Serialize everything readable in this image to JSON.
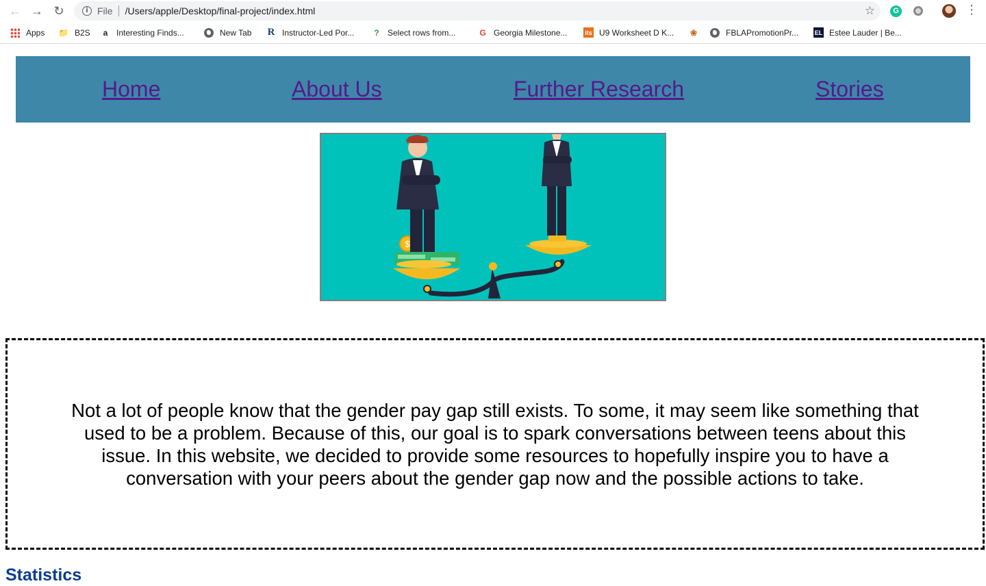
{
  "browser": {
    "scheme_label": "File",
    "url": "/Users/apple/Desktop/final-project/index.html",
    "bookmarks": [
      {
        "label": "Apps",
        "icon": "apps-grid-icon"
      },
      {
        "label": "B2S",
        "icon": "folder-icon"
      },
      {
        "label": "Interesting Finds...",
        "icon": "amazon-icon"
      },
      {
        "label": "New Tab",
        "icon": "globe-icon"
      },
      {
        "label": "Instructor-Led Por...",
        "icon": "r-logo-icon"
      },
      {
        "label": "Select rows from...",
        "icon": "question-icon"
      },
      {
        "label": "Georgia Milestone...",
        "icon": "google-icon"
      },
      {
        "label": "U9 Worksheet D K...",
        "icon": "its-icon"
      },
      {
        "label": "",
        "icon": "flower-icon"
      },
      {
        "label": "FBLAPromotionPr...",
        "icon": "globe-icon"
      },
      {
        "label": "Estee Lauder | Be...",
        "icon": "el-icon"
      }
    ]
  },
  "nav": {
    "home": "Home",
    "about": "About Us",
    "research": "Further Research",
    "stories": "Stories"
  },
  "intro": {
    "text": "Not a lot of people know that the gender pay gap still exists. To some, it may seem like something that used to be a problem. Because of this, our goal is to spark conversations between teens about this issue. In this website, we decided to provide some resources to hopefully inspire you to have a conversation with your peers about the gender gap now and the possible actions to take."
  },
  "sections": {
    "statistics_heading": "Statistics"
  },
  "colors": {
    "nav_bg": "#3e87a8",
    "link": "#551a8b",
    "hero_bg": "#00c2bb",
    "heading": "#0b3d91"
  }
}
